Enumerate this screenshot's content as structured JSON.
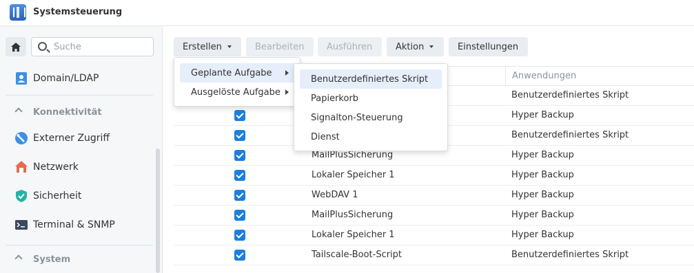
{
  "window": {
    "title": "Systemsteuerung"
  },
  "sidebar": {
    "search_placeholder": "Suche",
    "items": [
      {
        "label": "Domain/LDAP",
        "icon": "domain-ldap-icon"
      },
      {
        "section": "Konnektivität"
      },
      {
        "label": "Externer Zugriff",
        "icon": "external-access-icon"
      },
      {
        "label": "Netzwerk",
        "icon": "network-home-icon"
      },
      {
        "label": "Sicherheit",
        "icon": "security-shield-icon"
      },
      {
        "label": "Terminal & SNMP",
        "icon": "terminal-icon"
      },
      {
        "section": "System"
      }
    ]
  },
  "toolbar": {
    "create": "Erstellen",
    "edit": "Bearbeiten",
    "run": "Ausführen",
    "action": "Aktion",
    "settings": "Einstellungen"
  },
  "table": {
    "column_applications": "Anwendungen",
    "rows": [
      {
        "checked": true,
        "name": "",
        "app": "Benutzerdefiniertes Skript"
      },
      {
        "checked": true,
        "name": "",
        "app": "Hyper Backup"
      },
      {
        "checked": true,
        "name": "",
        "app": "Benutzerdefiniertes Skript"
      },
      {
        "checked": true,
        "name": "MailPlusSicherung",
        "app": "Hyper Backup"
      },
      {
        "checked": true,
        "name": "Lokaler Speicher 1",
        "app": "Hyper Backup"
      },
      {
        "checked": true,
        "name": "WebDAV 1",
        "app": "Hyper Backup"
      },
      {
        "checked": true,
        "name": "MailPlusSicherung",
        "app": "Hyper Backup"
      },
      {
        "checked": true,
        "name": "Lokaler Speicher 1",
        "app": "Hyper Backup"
      },
      {
        "checked": true,
        "name": "Tailscale-Boot-Script",
        "app": "Benutzerdefiniertes Skript"
      }
    ]
  },
  "create_menu": {
    "items": [
      {
        "label": "Geplante Aufgabe",
        "highlighted": true
      },
      {
        "label": "Ausgelöste Aufgabe",
        "highlighted": false
      }
    ]
  },
  "scheduled_submenu": {
    "items": [
      {
        "label": "Benutzerdefiniertes Skript",
        "highlighted": true
      },
      {
        "label": "Papierkorb"
      },
      {
        "label": "Signalton-Steuerung"
      },
      {
        "label": "Dienst"
      }
    ]
  },
  "colors": {
    "accent": "#1a7fe0",
    "highlight": "#e5eefa"
  }
}
